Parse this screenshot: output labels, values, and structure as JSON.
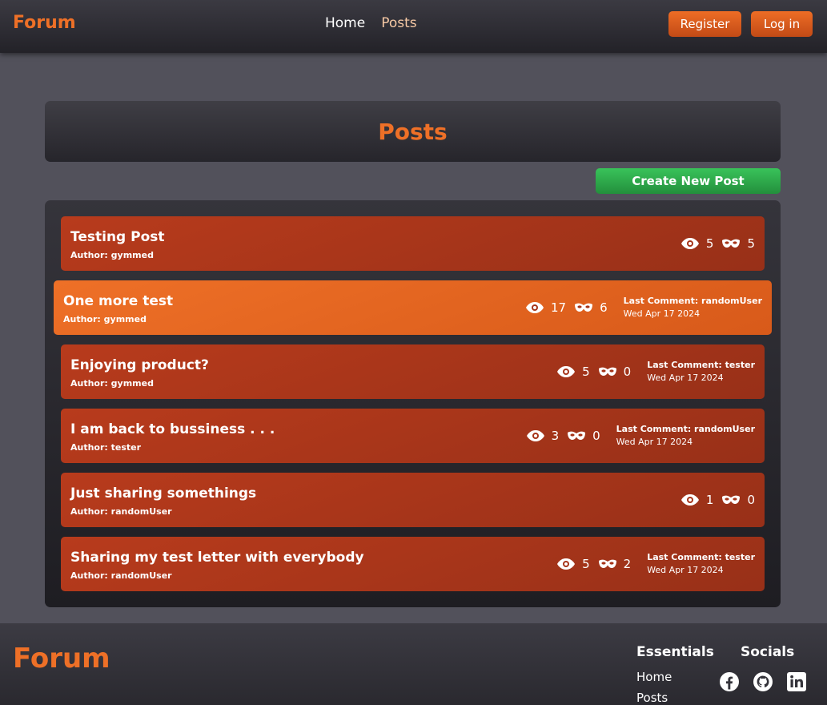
{
  "header": {
    "brand": "Forum",
    "nav": {
      "home": "Home",
      "posts": "Posts"
    },
    "register": "Register",
    "login": "Log in"
  },
  "main": {
    "title": "Posts",
    "create_button": "Create New Post",
    "posts": [
      {
        "title": "Testing Post",
        "author": "Author: gymmed",
        "views": "5",
        "comments": "5",
        "last_comment": "",
        "date": ""
      },
      {
        "title": "One more test",
        "author": "Author: gymmed",
        "views": "17",
        "comments": "6",
        "last_comment": "Last Comment: randomUser",
        "date": "Wed Apr 17 2024"
      },
      {
        "title": "Enjoying product?",
        "author": "Author: gymmed",
        "views": "5",
        "comments": "0",
        "last_comment": "Last Comment: tester",
        "date": "Wed Apr 17 2024"
      },
      {
        "title": "I am back to bussiness . . .",
        "author": "Author: tester",
        "views": "3",
        "comments": "0",
        "last_comment": "Last Comment: randomUser",
        "date": "Wed Apr 17 2024"
      },
      {
        "title": "Just sharing somethings",
        "author": "Author: randomUser",
        "views": "1",
        "comments": "0",
        "last_comment": "",
        "date": ""
      },
      {
        "title": "Sharing my test letter with everybody",
        "author": "Author: randomUser",
        "views": "5",
        "comments": "2",
        "last_comment": "Last Comment: tester",
        "date": "Wed Apr 17 2024"
      }
    ]
  },
  "footer": {
    "brand": "Forum",
    "essentials_title": "Essentials",
    "socials_title": "Socials",
    "links": {
      "home": "Home",
      "posts": "Posts"
    },
    "social_icons": [
      "facebook-icon",
      "github-icon",
      "linkedin-icon"
    ]
  },
  "colors": {
    "accent": "#ee7027",
    "post_bg": "#b83b1c",
    "create_green": "#39c35a",
    "page_bg": "#52515b"
  }
}
